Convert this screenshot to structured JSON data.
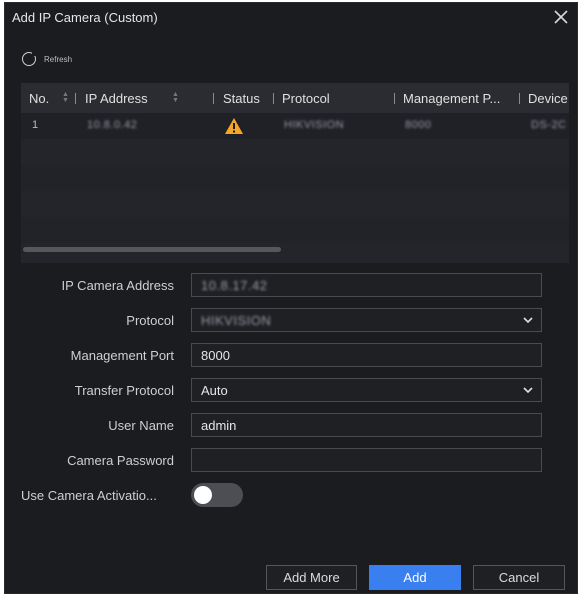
{
  "dialog": {
    "title": "Add IP Camera (Custom)",
    "close_icon": "close-icon"
  },
  "toolbar": {
    "refresh_label": "Refresh",
    "refresh_icon": "refresh-icon"
  },
  "table": {
    "columns": [
      "No.",
      "IP Address",
      "Status",
      "Protocol",
      "Management P...",
      "Device"
    ],
    "rows": [
      {
        "no": "1",
        "ip_address": "10.8.0.42",
        "status_icon": "warning-icon",
        "protocol": "HIKVISION",
        "management_port": "8000",
        "device": "DS-2C"
      }
    ]
  },
  "form": {
    "ip_address_label": "IP Camera Address",
    "ip_address_value": "10.8.17.42",
    "protocol_label": "Protocol",
    "protocol_value": "HIKVISION",
    "management_port_label": "Management Port",
    "management_port_value": "8000",
    "transfer_protocol_label": "Transfer Protocol",
    "transfer_protocol_value": "Auto",
    "user_name_label": "User Name",
    "user_name_value": "admin",
    "camera_password_label": "Camera Password",
    "camera_password_value": "",
    "activation_label": "Use Camera Activatio...",
    "activation_enabled": false
  },
  "buttons": {
    "add_more": "Add More",
    "add": "Add",
    "cancel": "Cancel"
  },
  "colors": {
    "background": "#1b1c20",
    "accent": "#3a7ff0",
    "warning": "#f5a623"
  }
}
